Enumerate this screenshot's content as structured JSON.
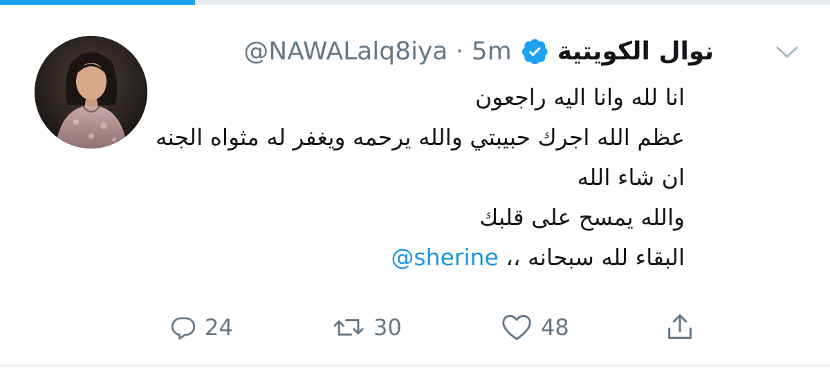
{
  "tweet": {
    "display_name": "نوال الكويتية",
    "handle": "@NAWALalq8iya",
    "separator": "·",
    "time": "5m",
    "verified": true,
    "lines": [
      "انا لله وانا اليه راجعون",
      "عظم الله اجرك حبيبتي والله يرحمه ويغفر له مثواه الجنه",
      "ان شاء الله",
      "والله يمسح على قلبك",
      "البقاء لله سبحانه ،،"
    ],
    "mention": "@sherine"
  },
  "actions": {
    "reply_count": "24",
    "retweet_count": "30",
    "like_count": "48"
  },
  "icons": {
    "reply": "reply-icon",
    "retweet": "retweet-icon",
    "like": "heart-icon",
    "share": "share-icon",
    "verified": "verified-badge-icon",
    "menu": "chevron-down-icon"
  },
  "colors": {
    "accent": "#1da1f2",
    "mention": "#1b95e0",
    "muted": "#657786",
    "text": "#14171a"
  },
  "load_progress": 0.235
}
